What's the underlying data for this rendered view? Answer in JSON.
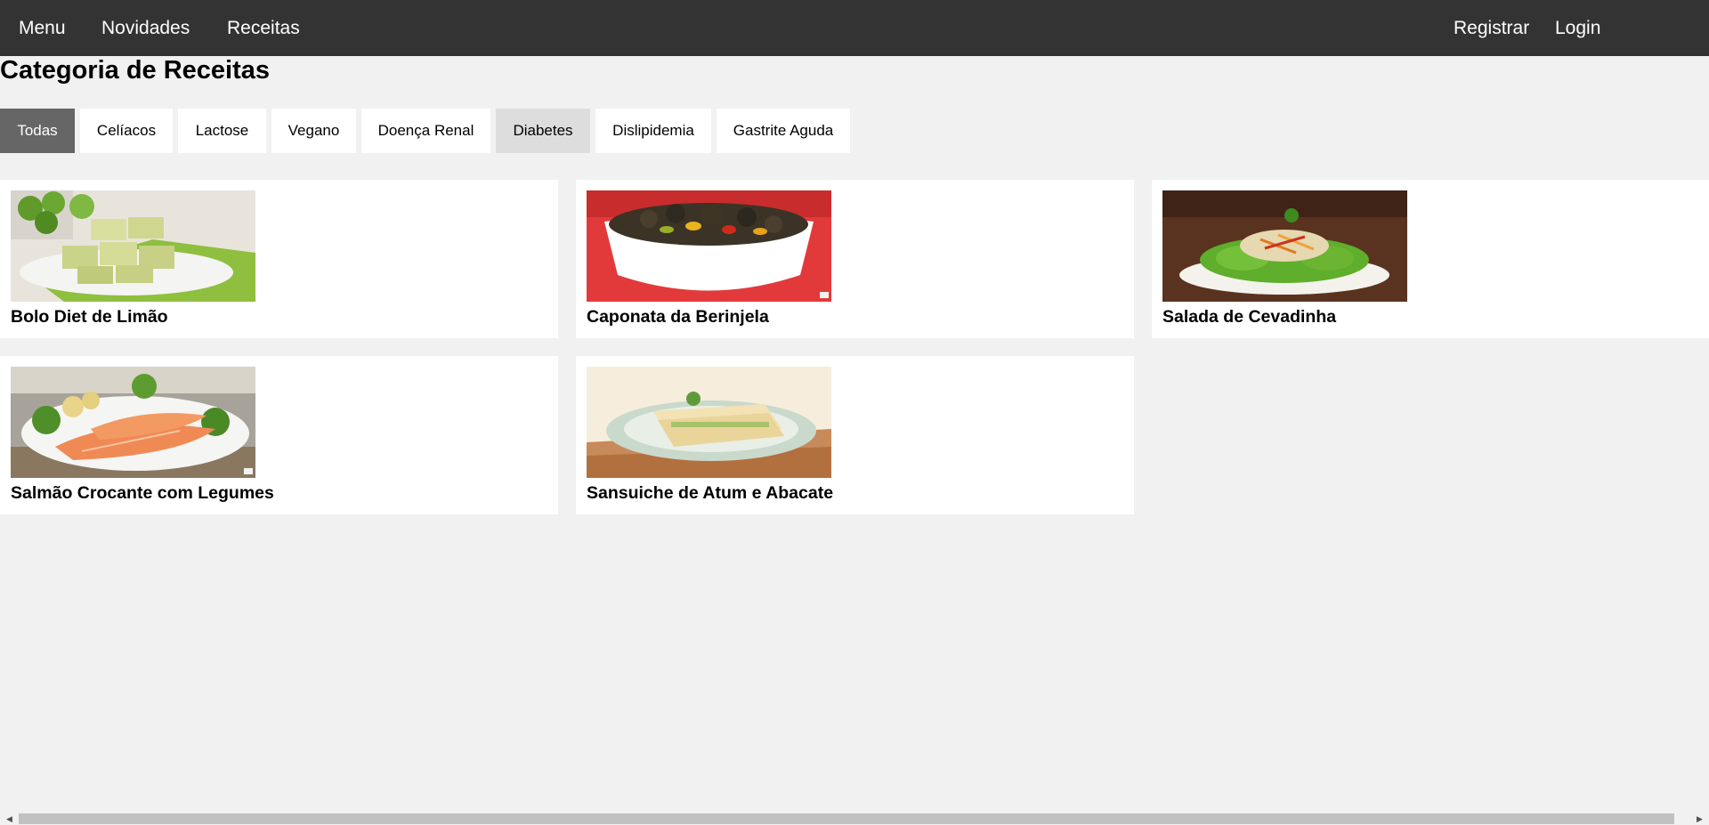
{
  "nav": {
    "left": [
      "Menu",
      "Novidades",
      "Receitas"
    ],
    "right": [
      "Registrar",
      "Login"
    ]
  },
  "page_title": "Categoria de Receitas",
  "filters": [
    {
      "label": "Todas",
      "state": "active"
    },
    {
      "label": "Celíacos",
      "state": "normal"
    },
    {
      "label": "Lactose",
      "state": "normal"
    },
    {
      "label": "Vegano",
      "state": "normal"
    },
    {
      "label": "Doença Renal",
      "state": "normal"
    },
    {
      "label": "Diabetes",
      "state": "hover"
    },
    {
      "label": "Dislipidemia",
      "state": "normal"
    },
    {
      "label": "Gastrite Aguda",
      "state": "normal"
    }
  ],
  "recipes": [
    {
      "title": "Bolo Diet de Limão",
      "image": "lemon-cake-photo"
    },
    {
      "title": "Caponata da Berinjela",
      "image": "caponata-photo"
    },
    {
      "title": "Salada de Cevadinha",
      "image": "barley-salad-photo"
    },
    {
      "title": "Salmão Crocante com Legumes",
      "image": "salmon-photo"
    },
    {
      "title": "Sansuiche de Atum e Abacate",
      "image": "sandwich-photo"
    }
  ],
  "colors": {
    "nav_bg": "#333333",
    "page_bg": "#f1f1f1",
    "active_filter": "#666666",
    "hover_filter": "#dddddd"
  }
}
